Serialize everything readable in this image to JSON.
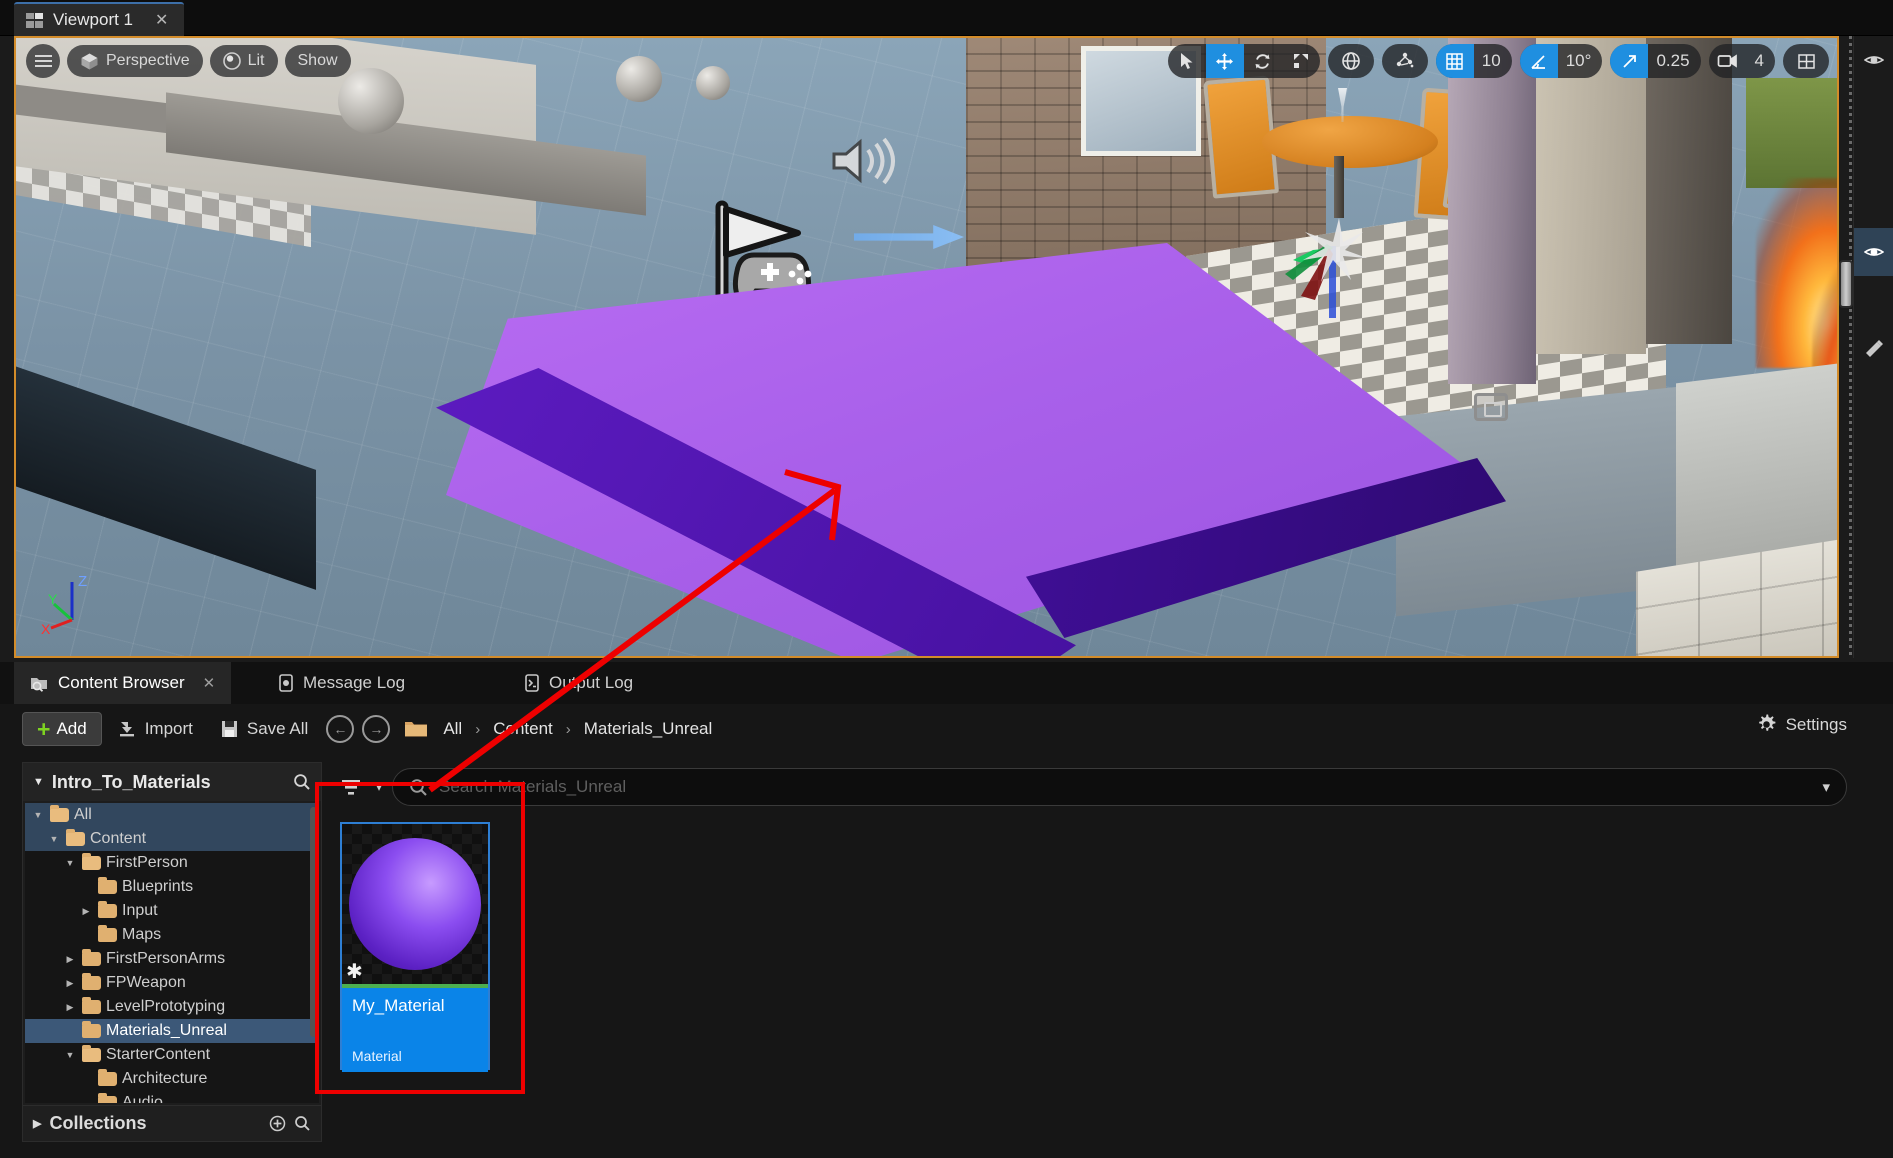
{
  "window": {
    "viewport_tab": {
      "label": "Viewport 1",
      "close": "✕",
      "icon": "viewport-layout-icon"
    }
  },
  "viewport": {
    "left_controls": [
      {
        "name": "menu",
        "icon": "hamburger-menu-icon",
        "label": ""
      },
      {
        "name": "camera-mode",
        "icon": "cube-icon",
        "label": "Perspective"
      },
      {
        "name": "view-mode",
        "icon": "lit-sphere-icon",
        "label": "Lit"
      },
      {
        "name": "show-flags",
        "icon": "",
        "label": "Show"
      }
    ],
    "right_controls": {
      "transform_tools": [
        {
          "name": "select-tool",
          "icon": "cursor-arrow-icon",
          "active": false
        },
        {
          "name": "translate-tool",
          "icon": "move-arrows-icon",
          "active": true
        },
        {
          "name": "rotate-tool",
          "icon": "rotate-icon",
          "active": false
        },
        {
          "name": "scale-tool",
          "icon": "scale-icon",
          "active": false
        }
      ],
      "coordinate_system": {
        "name": "world-coordinate-toggle",
        "icon": "globe-icon"
      },
      "surface_snap": {
        "name": "surface-snap-toggle",
        "icon": "surface-snap-icon"
      },
      "grid_snap": {
        "name": "grid-snap",
        "icon": "grid-icon",
        "value": "10",
        "active": true
      },
      "angle_snap": {
        "name": "angle-snap",
        "icon": "angle-icon",
        "value": "10°",
        "active": true
      },
      "scale_snap": {
        "name": "scale-snap",
        "icon": "diagonal-arrow-icon",
        "value": "0.25",
        "active": true
      },
      "camera_speed": {
        "name": "camera-speed",
        "icon": "camera-icon",
        "value": "4"
      },
      "layout": {
        "name": "viewport-layout",
        "icon": "layout-grid-icon"
      }
    },
    "axis_indicator": {
      "z": "Z",
      "y": "Y",
      "x": "X"
    },
    "scene_icons": {
      "player_start": "player-start-icon",
      "audio": "audio-speaker-icon",
      "camera": "camera-actor-icon"
    }
  },
  "bottom_panel": {
    "tabs": [
      {
        "label": "Content Browser",
        "icon": "content-browser-icon",
        "active": true,
        "close": "✕"
      },
      {
        "label": "Message Log",
        "icon": "message-log-icon",
        "active": false
      },
      {
        "label": "Output Log",
        "icon": "output-log-icon",
        "active": false
      }
    ],
    "toolbar": {
      "add_label": "Add",
      "add_icon": "plus-icon",
      "import_label": "Import",
      "import_icon": "import-icon",
      "save_all_label": "Save All",
      "save_all_icon": "save-icon",
      "back_icon": "arrow-back-icon",
      "forward_icon": "arrow-forward-icon",
      "settings_label": "Settings",
      "settings_icon": "gear-icon"
    },
    "breadcrumb": {
      "root_icon": "folder-icon",
      "items": [
        "All",
        "Content",
        "Materials_Unreal"
      ],
      "separator": "›"
    },
    "search": {
      "placeholder": "Search Materials_Unreal",
      "value": "",
      "search_icon": "search-icon",
      "filter_icon": "filter-icon",
      "chevron_icon": "chevron-down-icon"
    },
    "tree": {
      "title": "Intro_To_Materials",
      "title_chevron": "▼",
      "search_icon": "search-icon",
      "items": [
        {
          "label": "All",
          "depth": 0,
          "expander": "▼",
          "expanded": true,
          "selected_soft": true
        },
        {
          "label": "Content",
          "depth": 1,
          "expander": "▼",
          "expanded": true,
          "selected_soft": true
        },
        {
          "label": "FirstPerson",
          "depth": 2,
          "expander": "▼",
          "expanded": true
        },
        {
          "label": "Blueprints",
          "depth": 3,
          "expander": "",
          "expanded": false
        },
        {
          "label": "Input",
          "depth": 3,
          "expander": "▶",
          "expanded": false
        },
        {
          "label": "Maps",
          "depth": 3,
          "expander": "",
          "expanded": false
        },
        {
          "label": "FirstPersonArms",
          "depth": 2,
          "expander": "▶",
          "expanded": false
        },
        {
          "label": "FPWeapon",
          "depth": 2,
          "expander": "▶",
          "expanded": false
        },
        {
          "label": "LevelPrototyping",
          "depth": 2,
          "expander": "▶",
          "expanded": false
        },
        {
          "label": "Materials_Unreal",
          "depth": 2,
          "expander": "",
          "expanded": false,
          "selected": true
        },
        {
          "label": "StarterContent",
          "depth": 2,
          "expander": "▼",
          "expanded": true
        },
        {
          "label": "Architecture",
          "depth": 3,
          "expander": "",
          "expanded": false
        },
        {
          "label": "Audio",
          "depth": 3,
          "expander": "",
          "expanded": false
        }
      ],
      "collections": {
        "label": "Collections",
        "expander": "▶",
        "add_icon": "plus-circle-icon",
        "search_icon": "search-icon"
      }
    },
    "assets": [
      {
        "name": "My_Material",
        "type": "Material",
        "icon": "material-sphere-icon",
        "modified_icon": "asterisk-icon",
        "selected": true
      }
    ]
  },
  "annotation": {
    "color": "#ee0000",
    "shape": "arrow-and-box"
  }
}
